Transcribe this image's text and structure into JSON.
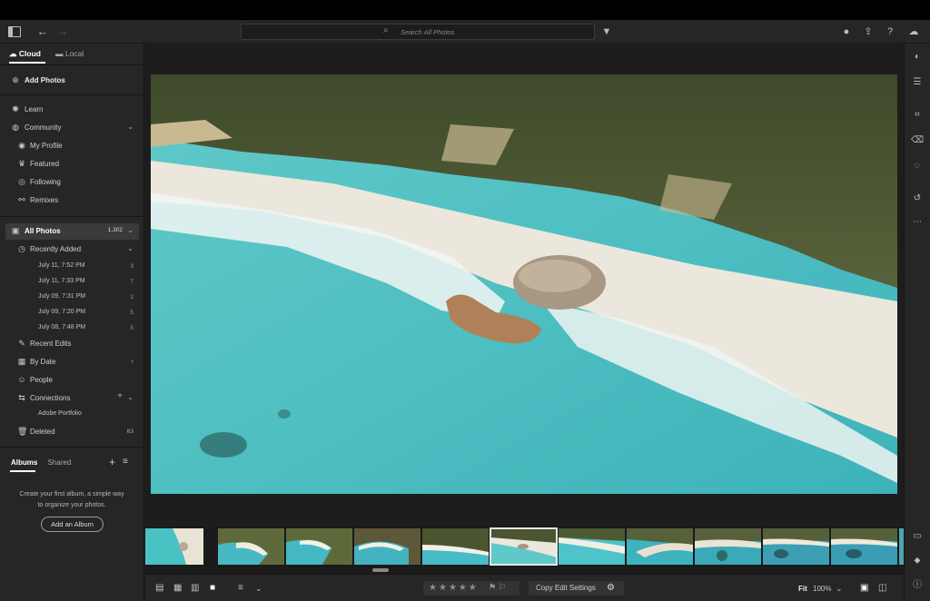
{
  "topbar": {
    "search_placeholder": "Search All Photos"
  },
  "sidebar": {
    "tabs": {
      "cloud": "Cloud",
      "local": "Local"
    },
    "add_photos": "Add Photos",
    "learn": "Learn",
    "community": "Community",
    "my_profile": "My Profile",
    "featured": "Featured",
    "following": "Following",
    "remixes": "Remixes",
    "all_photos": {
      "label": "All Photos",
      "count": "1,302"
    },
    "recently_added": "Recently Added",
    "dates": [
      {
        "label": "July 11, 7:52 PM",
        "count": "3"
      },
      {
        "label": "July 11, 7:33 PM",
        "count": "7"
      },
      {
        "label": "July 09, 7:31 PM",
        "count": "2"
      },
      {
        "label": "July 09, 7:20 PM",
        "count": "5"
      },
      {
        "label": "July 08, 7:48 PM",
        "count": "5"
      }
    ],
    "recent_edits": "Recent Edits",
    "by_date": "By Date",
    "people": "People",
    "connections": "Connections",
    "adobe_portfolio": "Adobe Portfolio",
    "deleted": {
      "label": "Deleted",
      "count": "63"
    },
    "albums_tab": "Albums",
    "shared_tab": "Shared",
    "albums_info": "Create your first album, a simple way to organize your photos.",
    "add_album": "Add an Album"
  },
  "bottom": {
    "copy_edit": "Copy Edit Settings",
    "fit": "Fit",
    "zoom": "100%"
  },
  "colors": {
    "accent": "#ffffff",
    "panel": "#262626",
    "canvas": "#1d1d1d"
  }
}
